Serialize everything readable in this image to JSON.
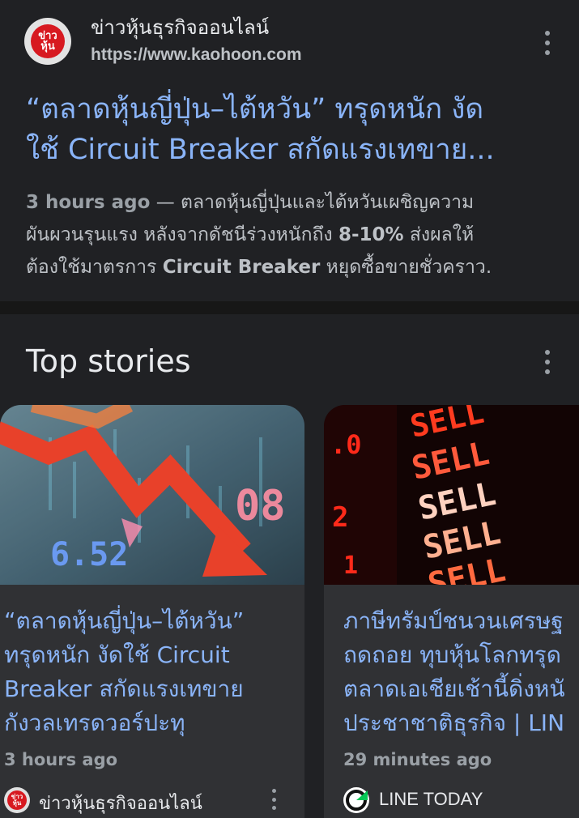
{
  "result": {
    "site_name": "ข่าวหุ้นธุรกิจออนไลน์",
    "site_url": "https://www.kaohoon.com",
    "logo_text": "ข่าว หุ้น",
    "logo_color": "#d71920",
    "title_lines": [
      "“ตลาดหุ้นญี่ปุ่น–ไต้หวัน” ทรุดหนัก งัด",
      "ใช้ Circuit Breaker สกัดแรงเทขาย..."
    ],
    "snippet": {
      "time": "3 hours ago",
      "dash": " — ",
      "line1_rest": "ตลาดหุ้นญี่ปุ่นและไต้หวันเผชิญความ",
      "line2_a": "ผันผวนรุนแรง หลังจากดัชนีร่วงหนักถึง ",
      "line2_b": "8-10%",
      "line2_c": " ส่งผลให้",
      "line3_a": "ต้องใช้มาตรการ ",
      "line3_b": "Circuit Breaker",
      "line3_c": " หยุดซื้อขายชั่วคราว."
    },
    "menu_icon": "more-vert-icon"
  },
  "top_stories": {
    "heading": "Top stories",
    "menu_icon": "more-vert-icon",
    "stories": [
      {
        "title_lines": [
          "“ตลาดหุ้นญี่ปุ่น–ไต้หวัน”",
          "ทรุดหนัก งัดใช้ Circuit",
          "Breaker สกัดแรงเทขาย",
          "กังวลเทรดวอร์ปะทุ"
        ],
        "time": "3 hours ago",
        "source": "ข่าวหุ้นธุรกิจออนไลน์",
        "source_icon_text": "ข่าว หุ้น",
        "thumb_text": [
          "08",
          "6.52"
        ]
      },
      {
        "title_lines": [
          "ภาษีทรัมป์ชนวนเศรษฐ",
          "ถดถอย ทุบหุ้นโลกทรุด",
          "ตลาดเอเชียเช้านี้ดิ่งหนั",
          "ประชาชาติธุรกิจ | LIN"
        ],
        "time": "29 minutes ago",
        "source": "LINE TODAY",
        "thumb_text": [
          "SELL",
          "SELL",
          "SELL",
          "SELL",
          "SELL"
        ]
      }
    ]
  },
  "colors": {
    "background": "#202124",
    "card": "#303134",
    "link": "#8ab4f8",
    "text": "#e8eaed",
    "muted": "#9aa0a6"
  }
}
